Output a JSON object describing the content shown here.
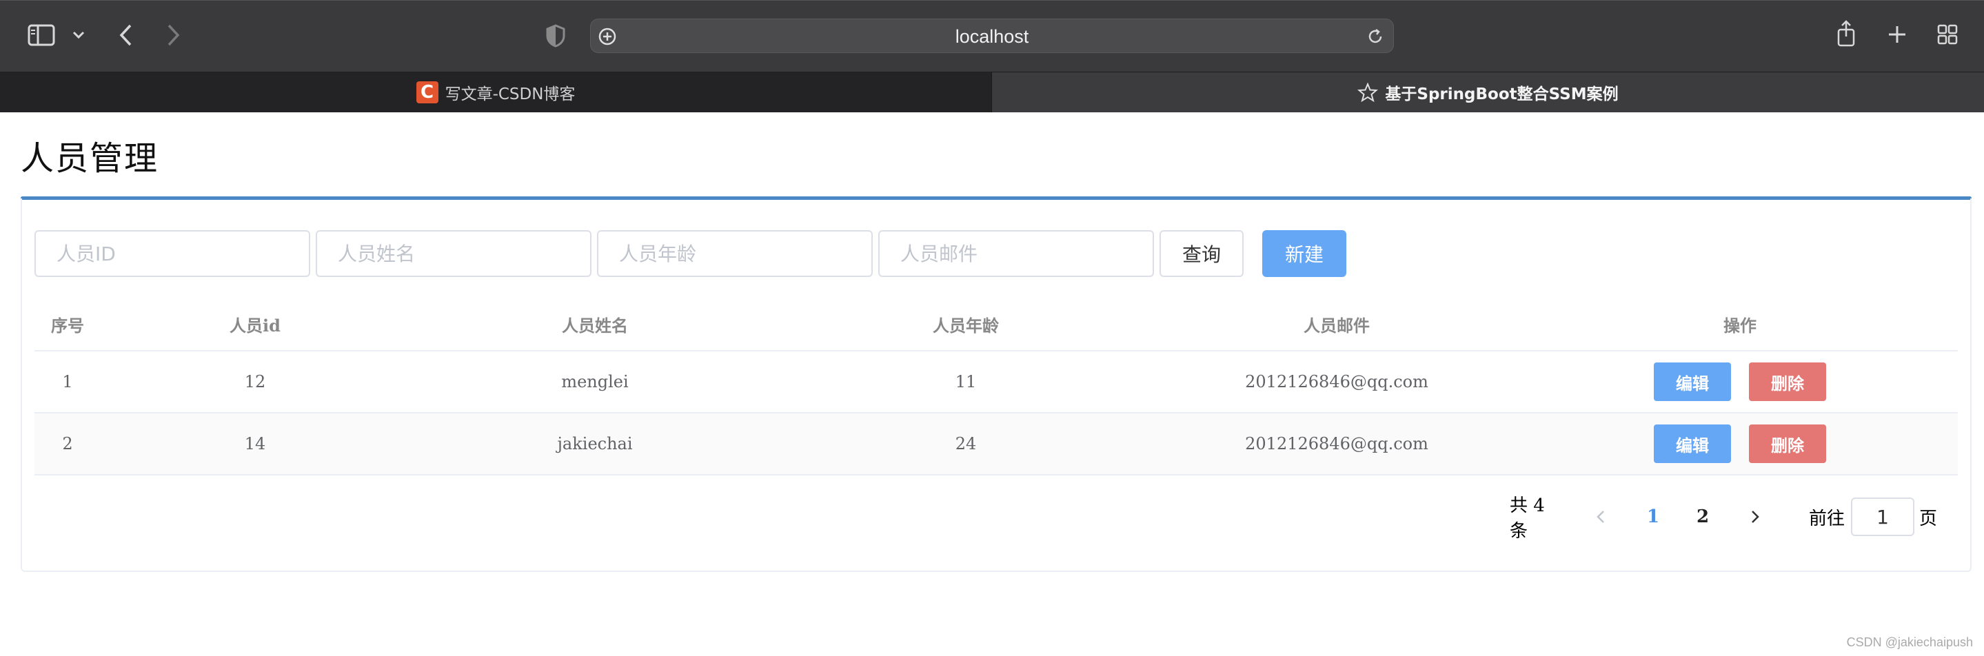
{
  "browser": {
    "url": "localhost",
    "tabs": [
      {
        "label": "写文章-CSDN博客",
        "icon": "csdn-icon",
        "logo_letter": "C"
      },
      {
        "label": "基于SpringBoot整合SSM案例",
        "icon": "star-icon"
      }
    ]
  },
  "page": {
    "title": "人员管理"
  },
  "search": {
    "id_placeholder": "人员ID",
    "name_placeholder": "人员姓名",
    "age_placeholder": "人员年龄",
    "email_placeholder": "人员邮件",
    "query_label": "查询",
    "new_label": "新建"
  },
  "table": {
    "headers": [
      "序号",
      "人员id",
      "人员姓名",
      "人员年龄",
      "人员邮件",
      "操作"
    ],
    "rows": [
      {
        "index": "1",
        "id": "12",
        "name": "menglei",
        "age": "11",
        "email": "2012126846@qq.com"
      },
      {
        "index": "2",
        "id": "14",
        "name": "jakiechai",
        "age": "24",
        "email": "2012126846@qq.com"
      }
    ],
    "edit_label": "编辑",
    "delete_label": "删除"
  },
  "pagination": {
    "total_label": "共 4 条",
    "pages": [
      "1",
      "2"
    ],
    "current_page": "1",
    "goto_label": "前往",
    "goto_value": "1",
    "page_suffix": "页"
  },
  "watermark": "CSDN @jakiechaipush",
  "colors": {
    "primary": "#66a7f5",
    "danger": "#e47674",
    "title_rule": "#4a88c5",
    "active_page": "#4a90e2"
  }
}
